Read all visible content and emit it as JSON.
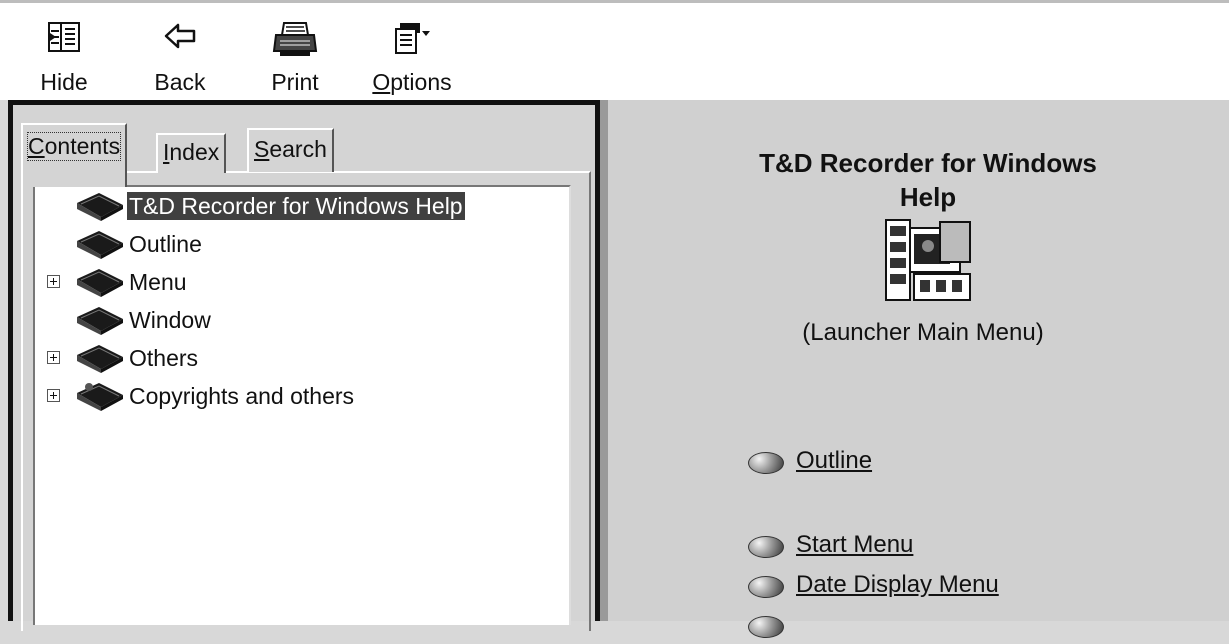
{
  "toolbar": {
    "hide_label": "Hide",
    "back_label": "Back",
    "print_label": "Print",
    "options_label_first": "O",
    "options_label_rest": "ptions"
  },
  "tabs": {
    "contents_first": "C",
    "contents_rest": "ontents",
    "index_first": "I",
    "index_rest": "ndex",
    "search_first": "S",
    "search_rest": "earch",
    "active": "Contents"
  },
  "tree": {
    "items": [
      {
        "label": "T&D Recorder for Windows Help",
        "selected": true,
        "expandable": false
      },
      {
        "label": "Outline",
        "selected": false,
        "expandable": false
      },
      {
        "label": "Menu",
        "selected": false,
        "expandable": true
      },
      {
        "label": "Window",
        "selected": false,
        "expandable": false
      },
      {
        "label": "Others",
        "selected": false,
        "expandable": true
      },
      {
        "label": "Copyrights and others",
        "selected": false,
        "expandable": true
      }
    ]
  },
  "content": {
    "title_line1": "T&D Recorder for Windows",
    "title_line2": "Help",
    "caption": "(Launcher Main Menu)",
    "links": [
      "Outline",
      "Start Menu",
      "Date Display Menu"
    ]
  },
  "icons": {
    "hide": "hide-pane-icon",
    "back": "back-arrow-icon",
    "print": "printer-icon",
    "options": "options-icon",
    "book": "closed-book-icon",
    "bullet": "round-bullet-icon",
    "launcher": "launcher-icon"
  },
  "colors": {
    "selection_bg": "#404040",
    "pane_border": "#111111",
    "toolbar_bg": "#ffffff",
    "content_bg": "#d0d0d0"
  }
}
